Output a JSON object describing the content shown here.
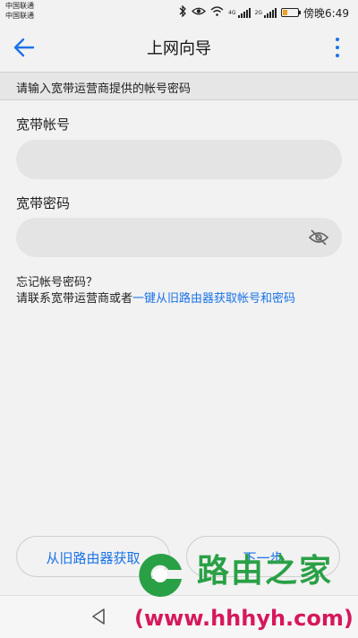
{
  "status_bar": {
    "carrier1": "中国联通",
    "carrier2": "中国联通",
    "net1": "4G",
    "net2": "2G",
    "time": "傍晚6:49"
  },
  "appbar": {
    "title": "上网向导"
  },
  "hint": "请输入宽带运营商提供的帐号密码",
  "form": {
    "account_label": "宽带帐号",
    "account_value": "",
    "password_label": "宽带密码",
    "password_value": ""
  },
  "help": {
    "line1": "忘记帐号密码？",
    "line2_prefix": "请联系宽带运营商或者",
    "line2_link": "一键从旧路由器获取帐号和密码"
  },
  "buttons": {
    "left": "从旧路由器获取",
    "right": "下一步"
  },
  "watermark": {
    "title": "路由之家",
    "url": "(www.hhhyh.com)"
  },
  "colors": {
    "accent": "#1a73e8",
    "watermark_green": "#2aa046",
    "watermark_pink": "#d6185c"
  }
}
